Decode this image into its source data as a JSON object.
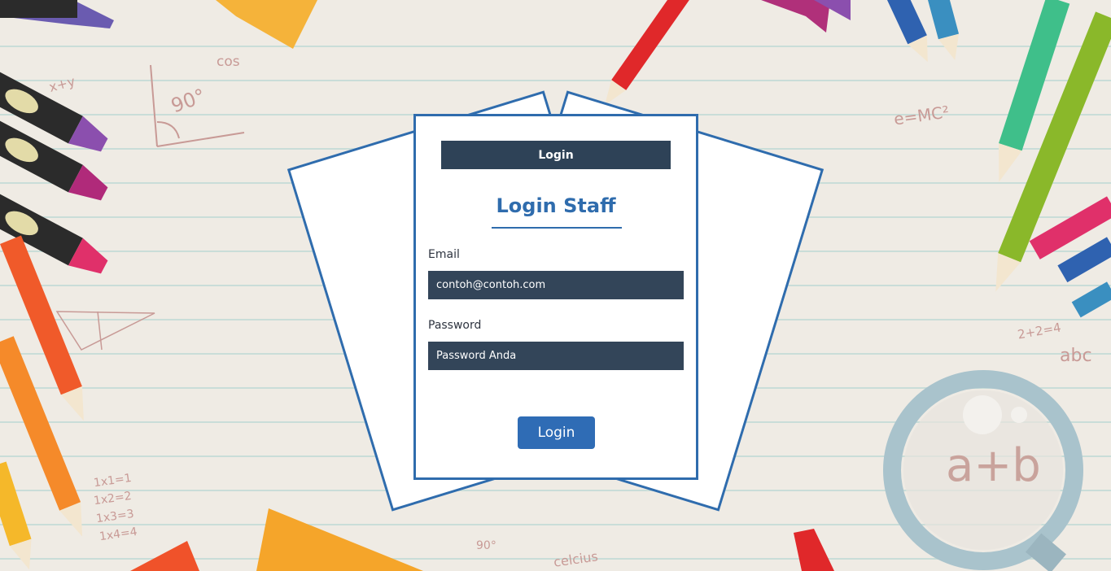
{
  "login_card": {
    "header_label": "Login",
    "title": "Login Staff",
    "email_label": "Email",
    "email_placeholder": "contoh@contoh.com",
    "password_label": "Password",
    "password_placeholder": "Password Anda",
    "submit_label": "Login"
  },
  "doodles": {
    "cos": "cos",
    "x_plus_y": "x+y",
    "ninety_deg": "90°",
    "emc2": "e=MC²",
    "two_plus_two": "2+2=4",
    "abc": "abc",
    "times_1": "1x1=1",
    "times_2": "1x2=2",
    "times_3": "1x3=3",
    "times_4": "1x4=4",
    "ninety_small": "90°",
    "celcius": "celcius",
    "a_plus_b": "a+b"
  },
  "colors": {
    "accent": "#2f6cad",
    "dark_field": "#334559",
    "paper_lines": "#c9ddd8"
  }
}
